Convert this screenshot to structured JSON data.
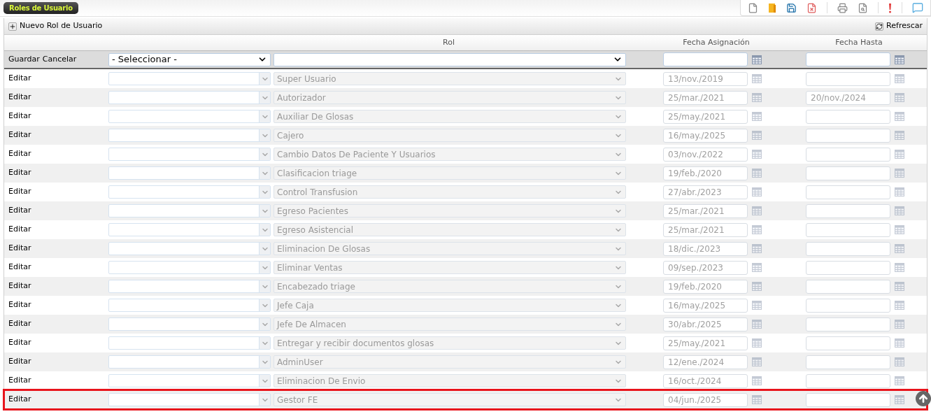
{
  "panel": {
    "title": "Roles de Usuario"
  },
  "toolbar": {
    "new_button": "Nuevo Rol de Usuario",
    "refresh_button": "Refrescar"
  },
  "table": {
    "columns": [
      "Rol",
      "Fecha Asignación",
      "Fecha Hasta"
    ],
    "filter_row": {
      "save": "Guardar",
      "cancel": "Cancelar",
      "select_placeholder": "- Seleccionar -"
    },
    "rows": [
      {
        "action": "Editar",
        "role": "Super Usuario",
        "fecha_asignacion": "13/nov./2019",
        "highlighted": false
      },
      {
        "action": "Editar",
        "role": "Autorizador",
        "fecha_asignacion": "25/mar./2021",
        "fecha_hasta": "20/nov./2024",
        "highlighted": false
      },
      {
        "action": "Editar",
        "role": "Auxiliar De Glosas",
        "fecha_asignacion": "25/may./2021",
        "highlighted": false
      },
      {
        "action": "Editar",
        "role": "Cajero",
        "fecha_asignacion": "16/may./2025",
        "highlighted": false
      },
      {
        "action": "Editar",
        "role": "Cambio Datos De Paciente Y Usuarios",
        "fecha_asignacion": "03/nov./2022",
        "highlighted": false
      },
      {
        "action": "Editar",
        "role": "Clasificacion triage",
        "fecha_asignacion": "19/feb./2020",
        "highlighted": false
      },
      {
        "action": "Editar",
        "role": "Control Transfusion",
        "fecha_asignacion": "27/abr./2023",
        "highlighted": false
      },
      {
        "action": "Editar",
        "role": "Egreso Pacientes",
        "fecha_asignacion": "25/mar./2021",
        "highlighted": false
      },
      {
        "action": "Editar",
        "role": "Egreso Asistencial",
        "fecha_asignacion": "25/mar./2021",
        "highlighted": false
      },
      {
        "action": "Editar",
        "role": "Eliminacion De Glosas",
        "fecha_asignacion": "18/dic./2023",
        "highlighted": false
      },
      {
        "action": "Editar",
        "role": "Eliminar Ventas",
        "fecha_asignacion": "09/sep./2023",
        "highlighted": false
      },
      {
        "action": "Editar",
        "role": "Encabezado triage",
        "fecha_asignacion": "19/feb./2020",
        "highlighted": false
      },
      {
        "action": "Editar",
        "role": "Jefe Caja",
        "fecha_asignacion": "16/may./2025",
        "highlighted": false
      },
      {
        "action": "Editar",
        "role": "Jefe De Almacen",
        "fecha_asignacion": "30/abr./2025",
        "highlighted": false
      },
      {
        "action": "Editar",
        "role": "Entregar y recibir documentos glosas",
        "fecha_asignacion": "25/may./2021",
        "highlighted": false
      },
      {
        "action": "Editar",
        "role": "AdminUser",
        "fecha_asignacion": "12/ene./2024",
        "highlighted": false
      },
      {
        "action": "Editar",
        "role": "Eliminacion De Envio",
        "fecha_asignacion": "16/oct./2024",
        "highlighted": false
      },
      {
        "action": "Editar",
        "role": "Gestor FE",
        "fecha_asignacion": "04/jun./2025",
        "highlighted": true
      }
    ]
  }
}
